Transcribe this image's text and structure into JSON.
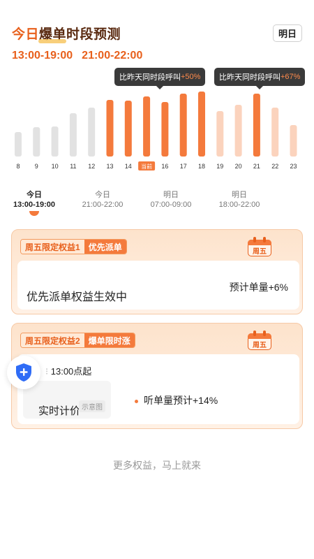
{
  "header": {
    "title_part1": "今日",
    "title_part2": "爆单时段预测",
    "tomorrow_button": "明日"
  },
  "peak_times": [
    "13:00-19:00",
    "21:00-22:00"
  ],
  "tooltips": [
    {
      "prefix": "比昨天同时段呼叫",
      "value": "+50%"
    },
    {
      "prefix": "比昨天同时段呼叫",
      "value": "+67%"
    }
  ],
  "chart_data": {
    "type": "bar",
    "categories": [
      "8",
      "9",
      "10",
      "11",
      "12",
      "13",
      "14",
      "当前",
      "16",
      "17",
      "18",
      "19",
      "20",
      "21",
      "22",
      "23"
    ],
    "values": [
      35,
      42,
      43,
      62,
      70,
      81,
      80,
      86,
      78,
      90,
      93,
      65,
      74,
      90,
      70,
      45
    ],
    "ylim": [
      0,
      100
    ],
    "current_label": "当前",
    "colors": {
      "inactive": "#e2e2e2",
      "peak": "#f47a3c",
      "fade": "#fbd3bd",
      "current_badge": "#f47a3c"
    },
    "peak_indices": [
      5,
      6,
      7,
      8,
      9,
      10,
      13
    ],
    "fade_indices": [
      11,
      12,
      14,
      15
    ]
  },
  "time_slots": [
    {
      "day": "今日",
      "range": "13:00-19:00",
      "active": true
    },
    {
      "day": "今日",
      "range": "21:00-22:00",
      "active": false
    },
    {
      "day": "明日",
      "range": "07:00-09:00",
      "active": false
    },
    {
      "day": "明日",
      "range": "18:00-22:00",
      "active": false
    }
  ],
  "card1": {
    "tag_a": "周五限定权益1",
    "tag_b": "优先派单",
    "calendar": "周五",
    "main_text": "优先派单权益生效中",
    "side_text": "预计单量+6%"
  },
  "card2": {
    "tag_a": "周五限定权益2",
    "tag_b": "爆单限时涨",
    "calendar": "周五",
    "start_text": "13:00点起",
    "main_text": "实时计价",
    "sample_tag": "示意图",
    "side_text": "听单量预计+14%"
  },
  "footer": "更多权益，马上就来",
  "colors": {
    "accent": "#e8601c",
    "accent_light": "#f47a3c",
    "shield": "#2f6cf6"
  }
}
